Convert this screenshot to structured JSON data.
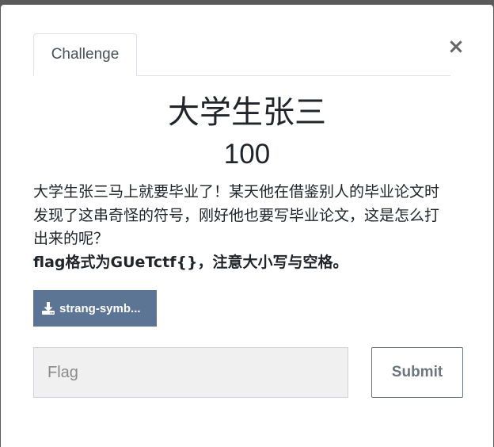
{
  "modal": {
    "tab_label": "Challenge",
    "close_symbol": "×",
    "title": "大学生张三",
    "value": "100",
    "description_lines": [
      "大学生张三马上就要毕业了！某天他在借鉴别人的毕业论文时",
      "发现了这串奇怪的符号，刚好他也要写毕业论文，这是怎么打",
      "出来的呢？"
    ],
    "flag_hint": "flag格式为GUeTctf{}，注意大小写与空格。",
    "file_button_label": "strang-symb...",
    "file_icon": "download-icon",
    "flag_placeholder": "Flag",
    "submit_label": "Submit"
  },
  "colors": {
    "file_button_bg": "#5c7594",
    "submit_border": "#6c757d",
    "input_bg": "#f0f0f0"
  }
}
